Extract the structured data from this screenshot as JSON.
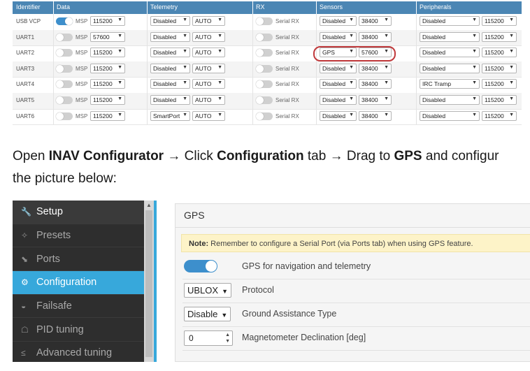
{
  "ports": {
    "headers": [
      "Identifier",
      "Data",
      "Telemetry",
      "RX",
      "Sensors",
      "Peripherals"
    ],
    "msp_label": "MSP",
    "rx_label": "Serial RX",
    "rows": [
      {
        "id": "USB VCP",
        "msp_on": true,
        "msp_baud": "115200",
        "tel": "Disabled",
        "tel_baud": "AUTO",
        "sens": "Disabled",
        "sens_baud": "38400",
        "per": "Disabled",
        "per_baud": "115200"
      },
      {
        "id": "UART1",
        "msp_on": false,
        "msp_baud": "57600",
        "tel": "Disabled",
        "tel_baud": "AUTO",
        "sens": "Disabled",
        "sens_baud": "38400",
        "per": "Disabled",
        "per_baud": "115200"
      },
      {
        "id": "UART2",
        "msp_on": false,
        "msp_baud": "115200",
        "tel": "Disabled",
        "tel_baud": "AUTO",
        "sens": "GPS",
        "sens_baud": "57600",
        "per": "Disabled",
        "per_baud": "115200"
      },
      {
        "id": "UART3",
        "msp_on": false,
        "msp_baud": "115200",
        "tel": "Disabled",
        "tel_baud": "AUTO",
        "sens": "Disabled",
        "sens_baud": "38400",
        "per": "Disabled",
        "per_baud": "115200"
      },
      {
        "id": "UART4",
        "msp_on": false,
        "msp_baud": "115200",
        "tel": "Disabled",
        "tel_baud": "AUTO",
        "sens": "Disabled",
        "sens_baud": "38400",
        "per": "IRC Tramp",
        "per_baud": "115200"
      },
      {
        "id": "UART5",
        "msp_on": false,
        "msp_baud": "115200",
        "tel": "Disabled",
        "tel_baud": "AUTO",
        "sens": "Disabled",
        "sens_baud": "38400",
        "per": "Disabled",
        "per_baud": "115200"
      },
      {
        "id": "UART6",
        "msp_on": false,
        "msp_baud": "115200",
        "tel": "SmartPort",
        "tel_baud": "AUTO",
        "sens": "Disabled",
        "sens_baud": "38400",
        "per": "Disabled",
        "per_baud": "115200"
      }
    ]
  },
  "instructions": {
    "t1": "Open ",
    "b1": "INAV Configurator",
    "arrow": " → ",
    "t2": "Click ",
    "b2": "Configuration",
    "t3": " tab",
    "t4": "Drag to ",
    "b3": "GPS",
    "t5": " and configur",
    "line2": "the picture below:"
  },
  "sidebar": {
    "items": [
      {
        "label": "Setup",
        "icon": "wrench-icon",
        "glyph": "🔧"
      },
      {
        "label": "Presets",
        "icon": "presets-icon",
        "glyph": "✧"
      },
      {
        "label": "Ports",
        "icon": "ports-icon",
        "glyph": "⬊"
      },
      {
        "label": "Configuration",
        "icon": "gear-icon",
        "glyph": "⚙"
      },
      {
        "label": "Failsafe",
        "icon": "parachute-icon",
        "glyph": "◒"
      },
      {
        "label": "PID tuning",
        "icon": "pid-icon",
        "glyph": "☖"
      },
      {
        "label": "Advanced tuning",
        "icon": "advanced-tuning-icon",
        "glyph": "≤"
      }
    ]
  },
  "gps": {
    "title": "GPS",
    "note_bold": "Note:",
    "note_text": " Remember to configure a Serial Port (via Ports tab) when using GPS feature.",
    "toggle_label": "GPS for navigation and telemetry",
    "protocol_value": "UBLOX",
    "protocol_label": "Protocol",
    "assist_value": "Disable",
    "assist_label": "Ground Assistance Type",
    "decl_value": "0",
    "decl_label": "Magnetometer Declination [deg]"
  },
  "colors": {
    "header_blue": "#4b86b4",
    "accent": "#37a8db",
    "highlight": "#c0393b",
    "toggle_on": "#3d8fcc"
  }
}
